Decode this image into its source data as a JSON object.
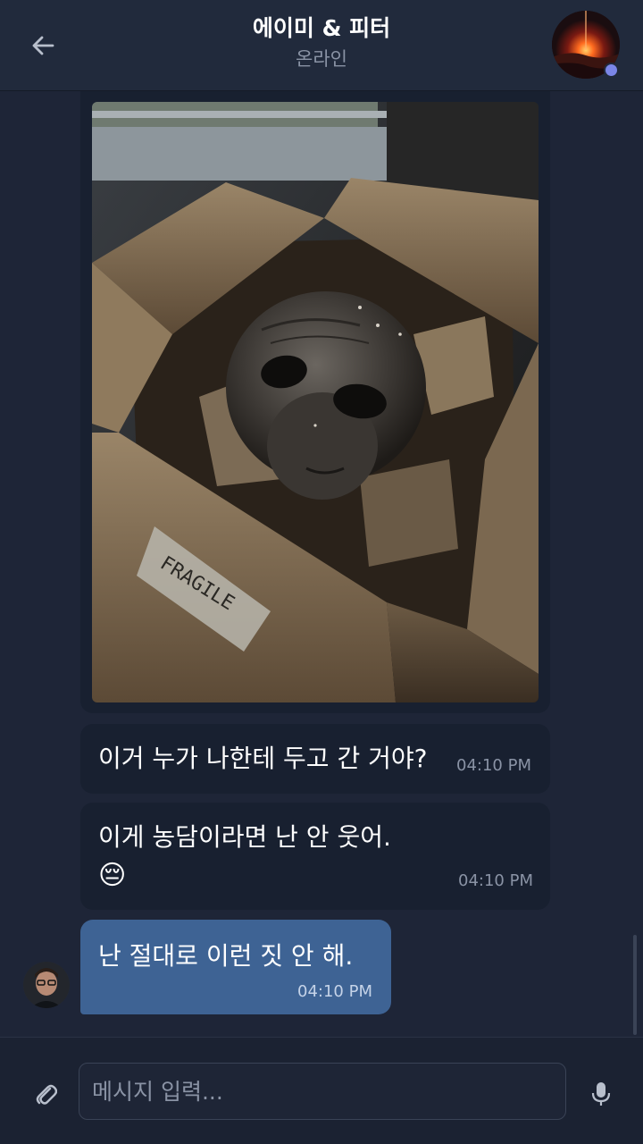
{
  "header": {
    "title": "에이미 & 피터",
    "status": "온라인",
    "back_icon": "arrow-left-icon",
    "avatar_description": "profile-photo"
  },
  "messages": [
    {
      "type": "image",
      "direction": "incoming",
      "fragile_label": "FRAGILE"
    },
    {
      "type": "text",
      "direction": "incoming",
      "text": "이거 누가 나한테 두고 간 거야?",
      "time": "04:10 PM"
    },
    {
      "type": "text",
      "direction": "incoming",
      "text": "이게 농담이라면 난 안 웃어.",
      "emoji": "😔",
      "time": "04:10 PM"
    },
    {
      "type": "text",
      "direction": "outgoing",
      "text": "난 절대로 이런 짓 안 해.",
      "time": "04:10 PM"
    }
  ],
  "composer": {
    "placeholder": "메시지 입력...",
    "value": "",
    "attach_icon": "paperclip-icon",
    "mic_icon": "microphone-icon"
  },
  "colors": {
    "background": "#1e2537",
    "header": "#212a3c",
    "incoming_bubble": "#182030",
    "outgoing_bubble": "#3e6394",
    "secondary_text": "#8a93a5",
    "online_dot": "#7b86e8"
  }
}
